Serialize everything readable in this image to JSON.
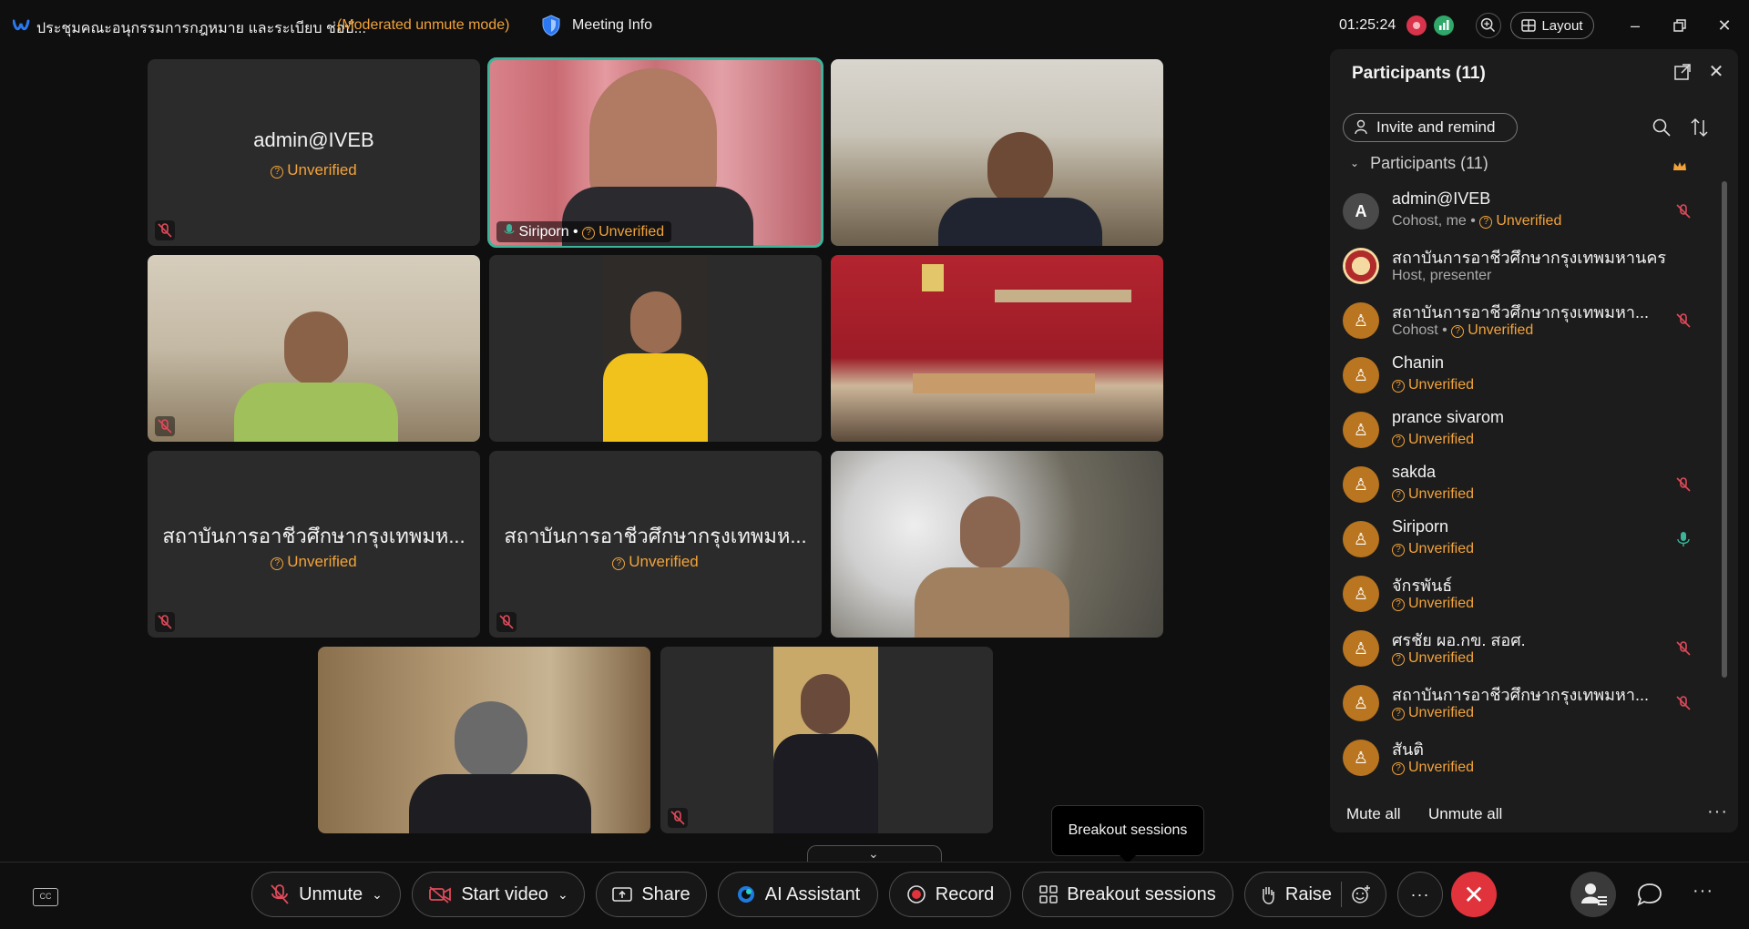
{
  "titlebar": {
    "meeting_title": "ประชุมคณะอนุกรรมการกฎหมาย และระเบียบ ช่อบั...",
    "mode": "(Moderated unmute mode)",
    "meeting_info": "Meeting Info",
    "timer": "01:25:24",
    "layout_label": "Layout"
  },
  "tiles": [
    {
      "name": "admin@IVEB",
      "status": "Unverified",
      "muted": true,
      "video": false
    },
    {
      "name": "Siriporn",
      "status": "Unverified",
      "muted": false,
      "video": true,
      "active": true
    },
    {
      "name": "",
      "status": "",
      "muted": false,
      "video": true
    },
    {
      "name": "",
      "status": "",
      "muted": true,
      "video": true
    },
    {
      "name": "",
      "status": "",
      "muted": false,
      "video": true
    },
    {
      "name": "",
      "status": "",
      "muted": false,
      "video": true
    },
    {
      "name": "สถาบันการอาชีวศึกษากรุงเทพมห...",
      "status": "Unverified",
      "muted": true,
      "video": false
    },
    {
      "name": "สถาบันการอาชีวศึกษากรุงเทพมห...",
      "status": "Unverified",
      "muted": true,
      "video": false
    },
    {
      "name": "",
      "status": "",
      "muted": false,
      "video": true
    },
    {
      "name": "",
      "status": "",
      "muted": false,
      "video": true
    },
    {
      "name": "",
      "status": "",
      "muted": true,
      "video": true
    }
  ],
  "panel": {
    "title": "Participants (11)",
    "invite_label": "Invite and remind",
    "section_label": "Participants (11)",
    "mute_all": "Mute all",
    "unmute_all": "Unmute all",
    "participants": [
      {
        "name": "admin@IVEB",
        "role": "Cohost, me",
        "status": "Unverified",
        "avatar": "A",
        "mic": "muted"
      },
      {
        "name": "สถาบันการอาชีวศึกษากรุงเทพมหานคร",
        "role": "Host, presenter",
        "status": "",
        "avatar": "seal",
        "mic": "none"
      },
      {
        "name": "สถาบันการอาชีวศึกษากรุงเทพมหา...",
        "role": "Cohost",
        "status": "Unverified",
        "avatar": "person",
        "mic": "muted"
      },
      {
        "name": "Chanin",
        "role": "",
        "status": "Unverified",
        "avatar": "person",
        "mic": "none"
      },
      {
        "name": "prance sivarom",
        "role": "",
        "status": "Unverified",
        "avatar": "person",
        "mic": "none"
      },
      {
        "name": "sakda",
        "role": "",
        "status": "Unverified",
        "avatar": "person",
        "mic": "muted"
      },
      {
        "name": "Siriporn",
        "role": "",
        "status": "Unverified",
        "avatar": "person",
        "mic": "active"
      },
      {
        "name": "จักรพันธ์",
        "role": "",
        "status": "Unverified",
        "avatar": "person",
        "mic": "none"
      },
      {
        "name": "ศรชัย ผอ.กข. สอศ.",
        "role": "",
        "status": "Unverified",
        "avatar": "person",
        "mic": "muted"
      },
      {
        "name": "สถาบันการอาชีวศึกษากรุงเทพมหา...",
        "role": "",
        "status": "Unverified",
        "avatar": "person",
        "mic": "muted"
      },
      {
        "name": "สันติ",
        "role": "",
        "status": "Unverified",
        "avatar": "person",
        "mic": "none"
      }
    ]
  },
  "tooltip": "Breakout sessions",
  "toolbar": {
    "unmute": "Unmute",
    "start_video": "Start video",
    "share": "Share",
    "ai_assistant": "AI Assistant",
    "record": "Record",
    "breakout": "Breakout sessions",
    "raise": "Raise"
  },
  "colors": {
    "accent": "#3bb49a",
    "unverified": "#f2a33a",
    "end": "#e0333b",
    "muted": "#d8334a"
  }
}
